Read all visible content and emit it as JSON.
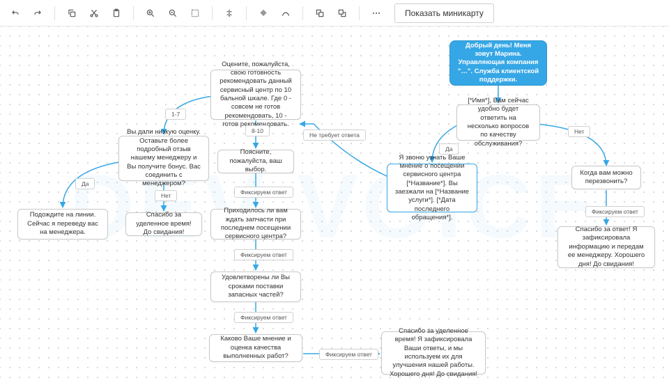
{
  "toolbar": {
    "minimap_label": "Показать миникарту",
    "icons": [
      "undo",
      "redo",
      "copy",
      "cut",
      "paste",
      "zoom-in",
      "zoom-out",
      "fit",
      "align-h",
      "fill",
      "stroke",
      "front",
      "back",
      "more"
    ]
  },
  "watermark_text": "DEV VOICE",
  "nodes": {
    "start": "Добрый день! Меня зовут Марина. Управляющая компания \"…\". Служба клиентской поддержки.",
    "ask_time": "[*Имя*], Вам сейчас удобно будет ответить на несколько вопросов по качеству обслуживания?",
    "callback": "Когда вам можно перезвонить?",
    "thanks_callback": "Спасибо за ответ! Я зафиксировала информацию и передам ее менеджеру. Хорошего дня! До свидания!",
    "purpose": "Я звоню узнать Ваше мнение о посещении сервисного центра [*Название*]. Вы заезжали на [*Название услуги*]. [*Дата последнего обращения*].",
    "rate": "Оцените, пожалуйста, свою готовность рекомендовать данный сервисный центр по 10 бальной шкале. Где 0 - совсем не готов рекомендовать, 10 - готов рекомендовать.",
    "low_score": "Вы дали низкую оценку. Оставьте более подробный отзыв нашему менеджеру и Вы получите бонус. Вас соединить с менеджером?",
    "transfer": "Подождите на линии. Сейчас я переведу вас на менеджера.",
    "bye_short": "Спасибо за уделенное время! До свидания!",
    "explain": "Поясните, пожалуйста, ваш выбор.",
    "wait_parts": "Приходилось ли вам ждать запчасти при последнем посещении сервисного центра?",
    "delivery": "Удовлетворены ли Вы сроками поставки запасных частей?",
    "quality": "Каково Ваше мнение и оценка качества выполненных работ?",
    "final": "Спасибо за уделенное время! Я зафиксировала Ваши ответы, и мы используем их для улучшения нашей работы. Хорошего дня! До свидания!"
  },
  "edge_labels": {
    "yes": "Да",
    "no": "Нет",
    "no_answer": "Не требует ответа",
    "rec_answer": "Фиксируем ответ",
    "r_1_7": "1-7",
    "r_8_10": "8-10"
  },
  "chart_data": {
    "type": "flowchart",
    "direction": "mixed",
    "nodes": [
      {
        "id": "start",
        "type": "start",
        "text_ref": "nodes.start"
      },
      {
        "id": "ask_time",
        "type": "decision",
        "text_ref": "nodes.ask_time"
      },
      {
        "id": "callback",
        "type": "process",
        "text_ref": "nodes.callback"
      },
      {
        "id": "thanks_callback",
        "type": "terminal",
        "text_ref": "nodes.thanks_callback"
      },
      {
        "id": "purpose",
        "type": "process",
        "text_ref": "nodes.purpose",
        "highlight": true
      },
      {
        "id": "rate",
        "type": "decision",
        "text_ref": "nodes.rate"
      },
      {
        "id": "low_score",
        "type": "decision",
        "text_ref": "nodes.low_score"
      },
      {
        "id": "transfer",
        "type": "terminal",
        "text_ref": "nodes.transfer"
      },
      {
        "id": "bye_short",
        "type": "terminal",
        "text_ref": "nodes.bye_short"
      },
      {
        "id": "explain",
        "type": "process",
        "text_ref": "nodes.explain"
      },
      {
        "id": "wait_parts",
        "type": "process",
        "text_ref": "nodes.wait_parts"
      },
      {
        "id": "delivery",
        "type": "process",
        "text_ref": "nodes.delivery"
      },
      {
        "id": "quality",
        "type": "process",
        "text_ref": "nodes.quality"
      },
      {
        "id": "final",
        "type": "terminal",
        "text_ref": "nodes.final"
      }
    ],
    "edges": [
      {
        "from": "start",
        "to": "ask_time",
        "label": null
      },
      {
        "from": "ask_time",
        "to": "purpose",
        "label_ref": "edge_labels.yes"
      },
      {
        "from": "ask_time",
        "to": "callback",
        "label_ref": "edge_labels.no"
      },
      {
        "from": "callback",
        "to": "thanks_callback",
        "label_ref": "edge_labels.rec_answer"
      },
      {
        "from": "purpose",
        "to": "rate",
        "label_ref": "edge_labels.no_answer"
      },
      {
        "from": "rate",
        "to": "low_score",
        "label_ref": "edge_labels.r_1_7"
      },
      {
        "from": "rate",
        "to": "explain",
        "label_ref": "edge_labels.r_8_10"
      },
      {
        "from": "low_score",
        "to": "transfer",
        "label_ref": "edge_labels.yes"
      },
      {
        "from": "low_score",
        "to": "bye_short",
        "label_ref": "edge_labels.no"
      },
      {
        "from": "explain",
        "to": "wait_parts",
        "label_ref": "edge_labels.rec_answer"
      },
      {
        "from": "wait_parts",
        "to": "delivery",
        "label_ref": "edge_labels.rec_answer"
      },
      {
        "from": "delivery",
        "to": "quality",
        "label_ref": "edge_labels.rec_answer"
      },
      {
        "from": "quality",
        "to": "final",
        "label_ref": "edge_labels.rec_answer"
      }
    ]
  }
}
